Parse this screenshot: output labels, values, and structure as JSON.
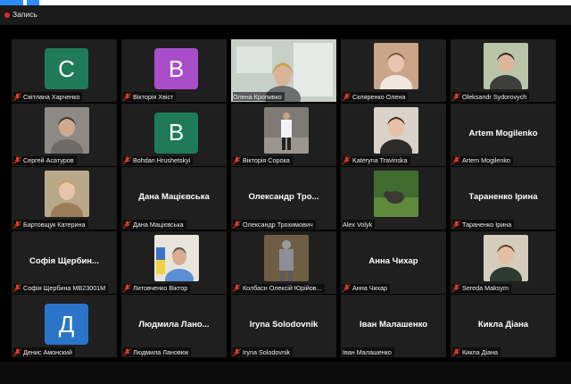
{
  "recording": {
    "label": "Запись"
  },
  "colors": {
    "purple": "#a94ec9",
    "green": "#1f7a5a",
    "blue": "#2a75c7",
    "mute": "#e0392d",
    "active_border": "#ead76a"
  },
  "tiles": [
    {
      "name": "Світлана Харченко",
      "muted": true,
      "kind": "avatar",
      "initial": "C",
      "color": "#1f7a5a"
    },
    {
      "name": "Вікторія Хвіст",
      "muted": true,
      "kind": "avatar",
      "initial": "B",
      "color": "#a94ec9"
    },
    {
      "name": "Олена Кропивко",
      "muted": false,
      "kind": "video",
      "active": true
    },
    {
      "name": "Скляренко Олена",
      "muted": true,
      "kind": "video"
    },
    {
      "name": "Oleksandr Sydorovych",
      "muted": true,
      "kind": "video"
    },
    {
      "name": "Сергей Асатуров",
      "muted": true,
      "kind": "video"
    },
    {
      "name": "Bohdan Hrushetskyi",
      "muted": true,
      "kind": "avatar",
      "initial": "B",
      "color": "#1f7a5a"
    },
    {
      "name": "Вікторія Сорока",
      "muted": true,
      "kind": "video"
    },
    {
      "name": "Kateryna Travinska",
      "muted": true,
      "kind": "video"
    },
    {
      "name": "Artem Mogilenko",
      "muted": true,
      "kind": "text",
      "big": "Artem Mogilenko"
    },
    {
      "name": "Бартовщук Катерина",
      "muted": true,
      "kind": "video"
    },
    {
      "name": "Дана Мацієвська",
      "muted": true,
      "kind": "text",
      "big": "Дана Мацієвська"
    },
    {
      "name": "Олександр Трохимович",
      "muted": true,
      "kind": "text",
      "big": "Олександр Тро..."
    },
    {
      "name": "Alex Volyk",
      "muted": false,
      "kind": "video"
    },
    {
      "name": "Тараненко Ірина",
      "muted": true,
      "kind": "text",
      "big": "Тараненко Ірина"
    },
    {
      "name": "Софія Щербина МВ23001М",
      "muted": true,
      "kind": "text",
      "big": "Софія Щербин..."
    },
    {
      "name": "Литовченко Віктор",
      "muted": true,
      "kind": "video"
    },
    {
      "name": "Колбасн Олексій Юрійов...",
      "muted": true,
      "kind": "video"
    },
    {
      "name": "Анна Чихар",
      "muted": true,
      "kind": "text",
      "big": "Анна Чихар"
    },
    {
      "name": "Sereda Maksym",
      "muted": true,
      "kind": "video"
    },
    {
      "name": "Денис Амонский",
      "muted": true,
      "kind": "avatar",
      "initial": "Д",
      "color": "#2a75c7"
    },
    {
      "name": "Людмила Лановюк",
      "muted": true,
      "kind": "text",
      "big": "Людмила Лано..."
    },
    {
      "name": "Iryna Solodovnik",
      "muted": true,
      "kind": "text",
      "big": "Iryna Solodovnik"
    },
    {
      "name": "Іван Малашенко",
      "muted": false,
      "kind": "text",
      "big": "Іван Малашенко"
    },
    {
      "name": "Кикла Діана",
      "muted": true,
      "kind": "text",
      "big": "Кикла Діана"
    }
  ]
}
